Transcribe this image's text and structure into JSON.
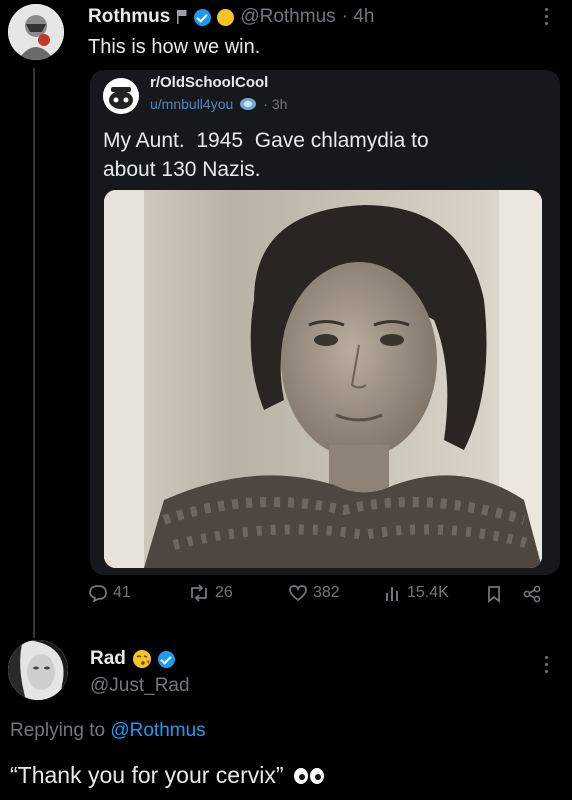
{
  "tweet": {
    "author_name": "Rothmus",
    "author_handle": "@Rothmus",
    "time": "· 4h",
    "text": "This is how we win."
  },
  "quoted": {
    "subreddit": "r/OldSchoolCool",
    "user": "u/mnbull4you",
    "time": "· 3h",
    "text_line1": "My Aunt.  1945  Gave chlamydia to",
    "text_line2": "about 130 Nazis."
  },
  "actions": {
    "replies": "41",
    "retweets": "26",
    "likes": "382",
    "views": "15.4K"
  },
  "reply": {
    "author_name": "Rad",
    "author_handle": "@Just_Rad",
    "replying_prefix": "Replying to ",
    "replying_handle": "@Rothmus",
    "text": "“Thank you for your cervix”"
  },
  "colors": {
    "background": "#000000",
    "link": "#1d9bf0",
    "muted": "#71767b",
    "verified": "#1d9bf0"
  }
}
